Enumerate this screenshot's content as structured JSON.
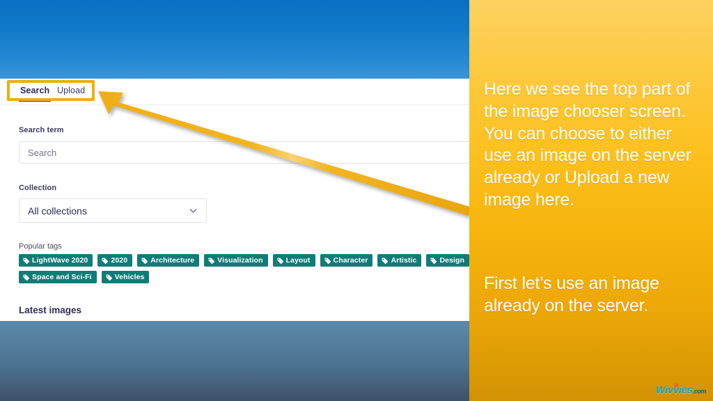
{
  "app": {
    "tabs": [
      {
        "id": "search",
        "label": "Search",
        "active": true
      },
      {
        "id": "upload",
        "label": "Upload",
        "active": false
      }
    ],
    "search_field": {
      "label": "Search term",
      "placeholder": "Search",
      "value": ""
    },
    "collection_field": {
      "label": "Collection",
      "selected": "All collections",
      "chevron_icon": "chevron-down-icon"
    },
    "tags_section": {
      "label": "Popular tags",
      "rows": [
        [
          "LightWave 2020",
          "2020",
          "Architecture",
          "Visualization",
          "Layout",
          "Character",
          "Artistic",
          "Design"
        ],
        [
          "Space and Sci-Fi",
          "Vehicles"
        ]
      ]
    },
    "latest_images_label": "Latest images"
  },
  "annotation": {
    "highlight_target": "search-upload-tabs",
    "arrow_icon": "arrow-pointing-left-up",
    "accent_color": "#eead12"
  },
  "narration": {
    "paragraph_1": "Here we see the top part of the image chooser screen. You can choose to either use an image on the server already or Upload a new image here.",
    "paragraph_2": "First let’s use an image already on the server."
  },
  "watermark": {
    "name": "Wivvies",
    "tld": ".com"
  },
  "colors": {
    "header_blue_top": "#0a6fc2",
    "header_blue_bottom": "#3a94d8",
    "footer_blue_top": "#5b88a9",
    "footer_blue_bottom": "#3f5169",
    "tag_teal": "#107c77",
    "panel_yellow_top": "#fdd261",
    "panel_yellow_bottom": "#d29204",
    "highlight_amber": "#eead12",
    "tab_active_underline": "#3c3a73"
  }
}
